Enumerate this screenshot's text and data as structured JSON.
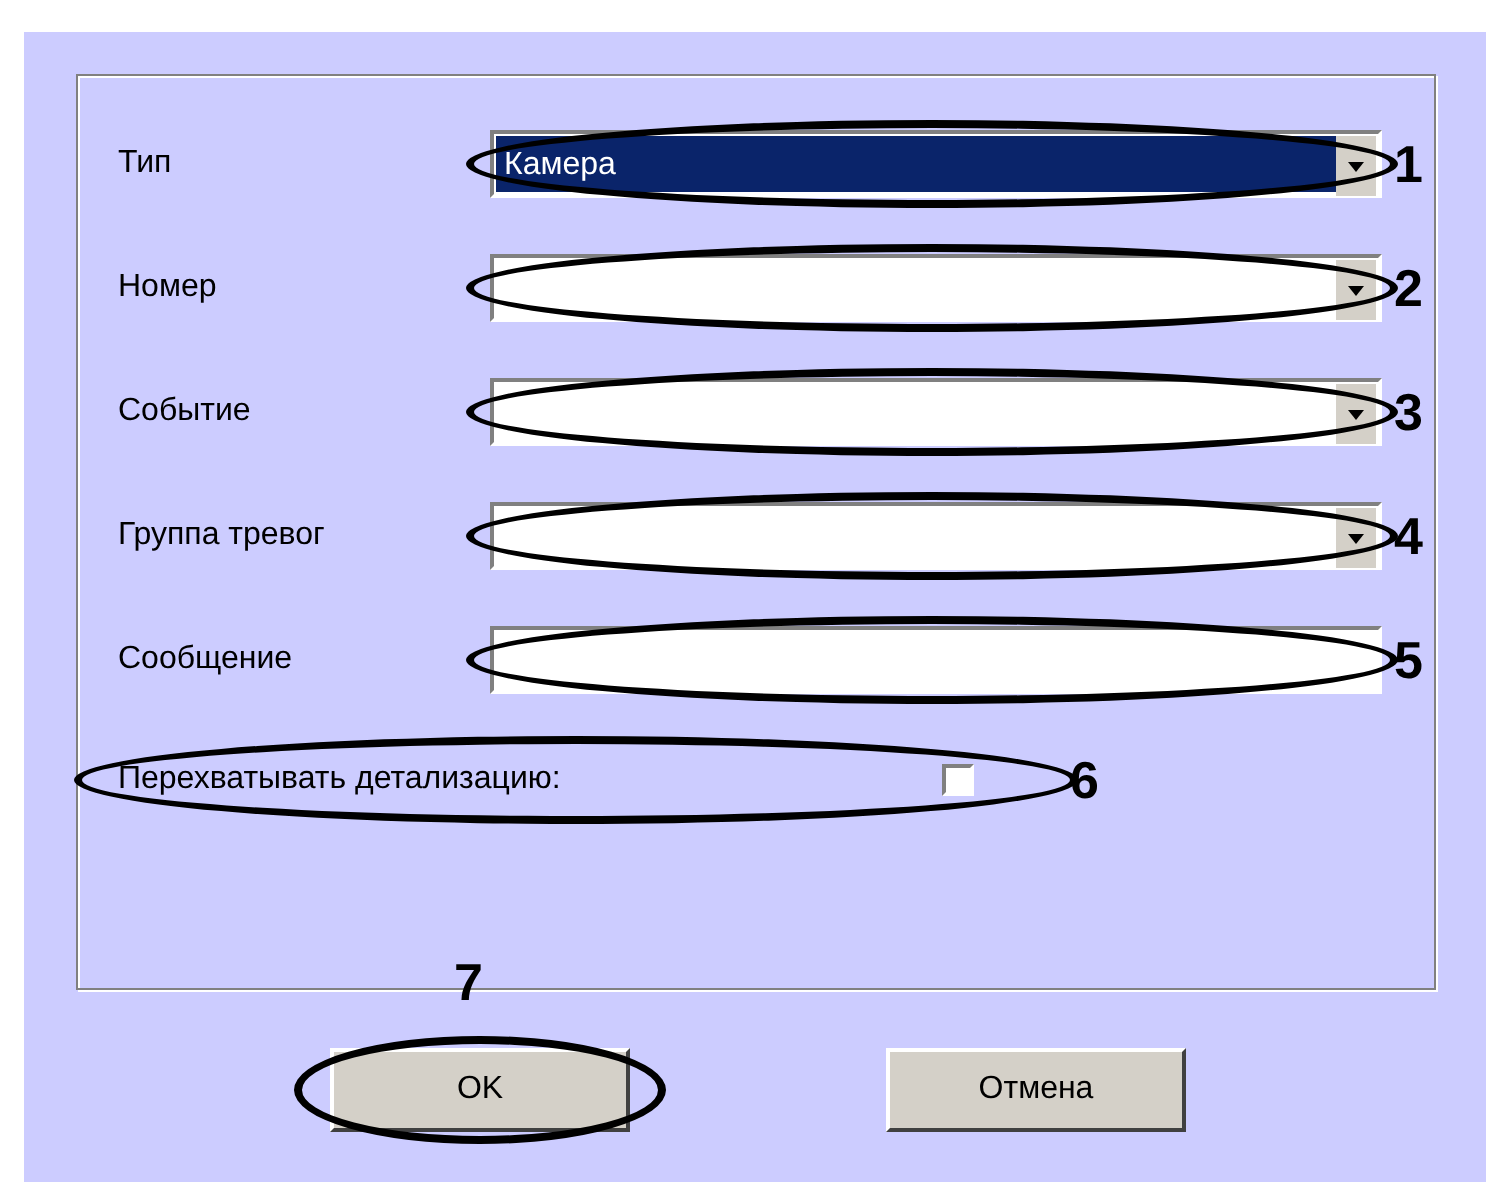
{
  "fields": [
    {
      "label": "Тип",
      "kind": "combo",
      "value": "Камера",
      "selected": true,
      "annotation": "1"
    },
    {
      "label": "Номер",
      "kind": "combo",
      "selected": false,
      "annotation": "2"
    },
    {
      "label": "Событие",
      "kind": "combo",
      "selected": false,
      "annotation": "3"
    },
    {
      "label": "Группа тревог",
      "kind": "combo",
      "selected": false,
      "annotation": "4"
    },
    {
      "label": "Сообщение",
      "kind": "text",
      "selected": false,
      "annotation": "5"
    }
  ],
  "checkbox": {
    "label": "Перехватывать детализацию:",
    "checked": false,
    "annotation": "6"
  },
  "buttons": [
    {
      "label": "OK",
      "annotation": "7"
    },
    {
      "label": "Отмена"
    }
  ]
}
